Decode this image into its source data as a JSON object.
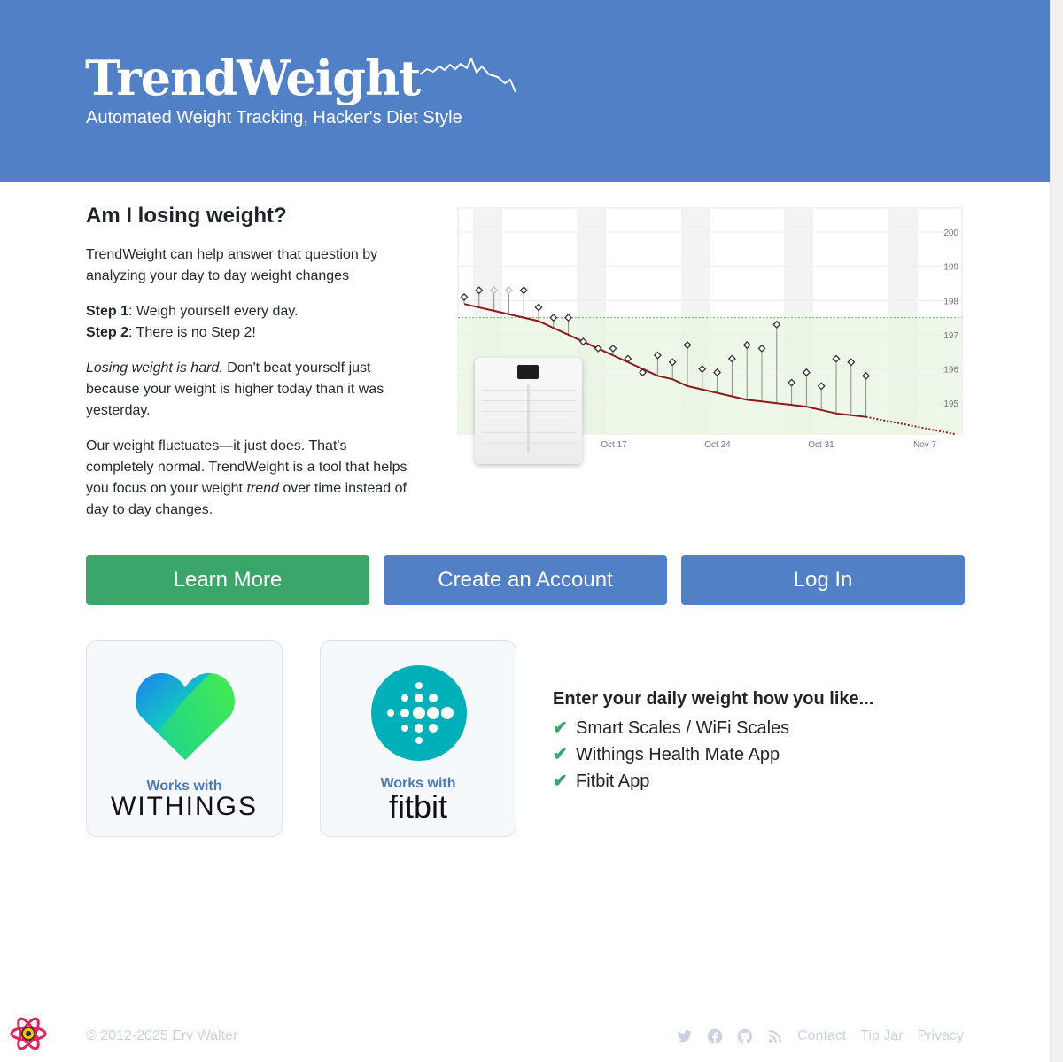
{
  "header": {
    "title": "TrendWeight",
    "subtitle": "Automated Weight Tracking, Hacker's Diet Style",
    "bg_color": "#5180c6"
  },
  "intro": {
    "heading": "Am I losing weight?",
    "p1": "TrendWeight can help answer that question by analyzing your day to day weight changes",
    "step1_label": "Step 1",
    "step1_text": ": Weigh yourself every day.",
    "step2_label": "Step 2",
    "step2_text": ": There is no Step 2!",
    "p3_em": "Losing weight is hard.",
    "p3_rest": " Don't beat yourself just because your weight is higher today than it was yesterday.",
    "p4_a": "Our weight fluctuates—it just does. That's completely normal. TrendWeight is a tool that helps you focus on your weight ",
    "p4_em": "trend",
    "p4_b": " over time instead of day to day changes."
  },
  "chart_data": {
    "type": "line",
    "y_ticks": [
      "200",
      "199",
      "198",
      "197",
      "196",
      "195"
    ],
    "x_ticks": [
      "Oct 17",
      "Oct 24",
      "Oct 31",
      "Nov 7"
    ],
    "ylim": [
      194.1,
      200.7
    ],
    "goal_line": 197.5,
    "trend": [
      197.9,
      197.8,
      197.7,
      197.6,
      197.5,
      197.4,
      197.2,
      197.0,
      196.8,
      196.6,
      196.4,
      196.2,
      196.0,
      195.8,
      195.7,
      195.5,
      195.4,
      195.3,
      195.2,
      195.1,
      195.05,
      195.0,
      194.95,
      194.9,
      194.8,
      194.7,
      194.65,
      194.6
    ],
    "trend_projection": [
      194.6,
      194.5,
      194.4,
      194.3,
      194.2,
      194.1
    ],
    "scale_readings": [
      198.1,
      198.3,
      198.3,
      198.3,
      198.3,
      197.8,
      197.5,
      197.5,
      196.8,
      196.6,
      196.6,
      196.3,
      195.9,
      196.4,
      196.2,
      196.7,
      196.0,
      195.9,
      196.3,
      196.7,
      196.6,
      197.3,
      195.6,
      195.9,
      195.5,
      196.3,
      196.2,
      195.8
    ],
    "faded_points": [
      2,
      3
    ],
    "series": [
      {
        "name": "trend",
        "color": "#8b1a1a"
      },
      {
        "name": "scale",
        "color": "#333333"
      }
    ]
  },
  "buttons": {
    "learn_more": "Learn More",
    "create_account": "Create an Account",
    "log_in": "Log In"
  },
  "cards": {
    "withings_works": "Works with",
    "withings_name": "WITHINGS",
    "fitbit_works": "Works with",
    "fitbit_name": "fitbit"
  },
  "features": {
    "heading": "Enter your daily weight how you like...",
    "items": [
      "Smart Scales / WiFi Scales",
      "Withings Health Mate App",
      "Fitbit App"
    ]
  },
  "footer": {
    "copyright": "© 2012-2025 Erv Walter",
    "links": [
      "Contact",
      "Tip Jar",
      "Privacy"
    ],
    "icons": [
      "twitter-icon",
      "facebook-icon",
      "github-icon",
      "rss-icon"
    ]
  }
}
